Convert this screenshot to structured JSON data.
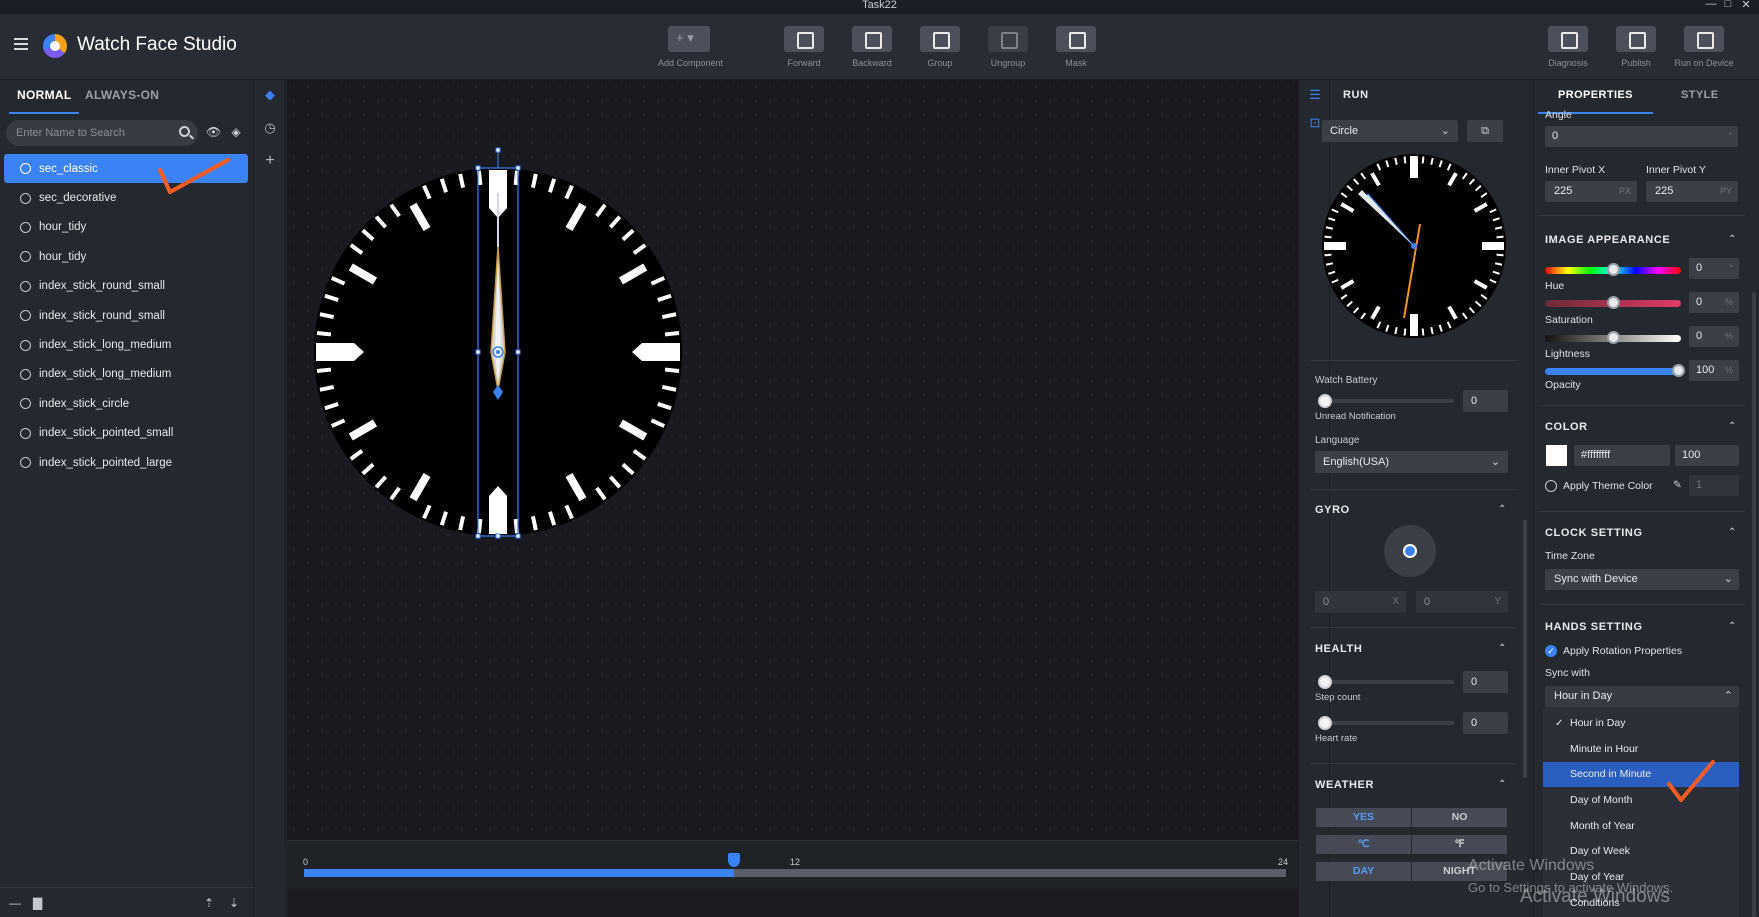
{
  "window": {
    "title": "Task22"
  },
  "header": {
    "app_name": "Watch Face Studio",
    "tools": [
      {
        "label": "Add Component",
        "icon": "add-icon"
      },
      {
        "label": "Forward",
        "icon": "forward-icon"
      },
      {
        "label": "Backward",
        "icon": "backward-icon"
      },
      {
        "label": "Group",
        "icon": "group-icon"
      },
      {
        "label": "Ungroup",
        "icon": "ungroup-icon"
      },
      {
        "label": "Mask",
        "icon": "mask-icon"
      },
      {
        "label": "Diagnosis",
        "icon": "diagnosis-icon"
      },
      {
        "label": "Publish",
        "icon": "publish-icon"
      },
      {
        "label": "Run on Device",
        "icon": "run-on-device-icon"
      }
    ]
  },
  "left_panel": {
    "tabs": [
      "NORMAL",
      "ALWAYS-ON"
    ],
    "search_placeholder": "Enter Name to Search",
    "layers": [
      {
        "name": "sec_classic",
        "selected": true
      },
      {
        "name": "sec_decorative"
      },
      {
        "name": "hour_tidy"
      },
      {
        "name": "hour_tidy"
      },
      {
        "name": "index_stick_round_small"
      },
      {
        "name": "index_stick_round_small"
      },
      {
        "name": "index_stick_long_medium"
      },
      {
        "name": "index_stick_long_medium"
      },
      {
        "name": "index_stick_circle"
      },
      {
        "name": "index_stick_pointed_small"
      },
      {
        "name": "index_stick_pointed_large"
      }
    ]
  },
  "timeline": {
    "start": "0",
    "mid": "12",
    "end": "24",
    "position_hours": 10.5
  },
  "run_panel": {
    "title": "RUN",
    "shape": "Circle",
    "watch_battery_label": "Watch Battery",
    "unread_label": "Unread Notification",
    "unread_value": "0",
    "language_label": "Language",
    "language_value": "English(USA)",
    "gyro_title": "GYRO",
    "gyro_x": "0",
    "gyro_x_unit": "X",
    "gyro_y": "0",
    "gyro_y_unit": "Y",
    "health_title": "HEALTH",
    "step_value": "0",
    "step_label": "Step count",
    "heart_value": "0",
    "heart_label": "Heart rate",
    "weather_title": "WEATHER",
    "weather_yes": "YES",
    "weather_no": "NO",
    "unit_c": "℃",
    "unit_f": "℉",
    "day": "DAY",
    "night": "NIGHT"
  },
  "properties": {
    "tabs": [
      "PROPERTIES",
      "STYLE"
    ],
    "angle_label": "Angle",
    "angle_value": "0",
    "angle_unit": "°",
    "pivot_x_label": "Inner Pivot X",
    "pivot_x_value": "225",
    "pivot_x_unit": "PX",
    "pivot_y_label": "Inner Pivot Y",
    "pivot_y_value": "225",
    "pivot_y_unit": "PY",
    "image_appearance_title": "IMAGE APPEARANCE",
    "hue_label": "Hue",
    "hue_value": "0",
    "hue_unit": "°",
    "saturation_label": "Saturation",
    "saturation_value": "0",
    "saturation_unit": "%",
    "lightness_label": "Lightness",
    "lightness_value": "0",
    "lightness_unit": "%",
    "opacity_label": "Opacity",
    "opacity_value": "100",
    "opacity_unit": "%",
    "color_title": "COLOR",
    "color_hex": "#ffffffff",
    "color_opacity": "100",
    "apply_theme_label": "Apply Theme Color",
    "theme_value": "1",
    "clock_setting_title": "CLOCK SETTING",
    "time_zone_label": "Time Zone",
    "time_zone_value": "Sync with Device",
    "hands_setting_title": "HANDS SETTING",
    "apply_rotation_label": "Apply Rotation Properties",
    "sync_with_label": "Sync with",
    "sync_with_value": "Hour in Day",
    "sync_options": [
      {
        "label": "Hour in Day",
        "checked": true
      },
      {
        "label": "Minute in Hour"
      },
      {
        "label": "Second in Minute",
        "highlighted": true
      },
      {
        "label": "Day of Month"
      },
      {
        "label": "Month of Year"
      },
      {
        "label": "Day of Week"
      },
      {
        "label": "Day of Year"
      },
      {
        "label": "Conditions"
      }
    ]
  },
  "watermark": {
    "line1": "Activate Windows",
    "line2": "Go to Settings to activate Windows.",
    "line3": "Activate Windows"
  },
  "colors": {
    "accent": "#3b82f6",
    "annotation": "#ff5a1f",
    "bg": "#23272f"
  }
}
